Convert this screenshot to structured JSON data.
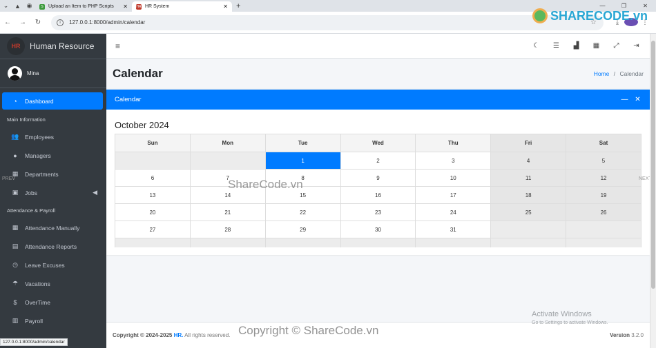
{
  "browser": {
    "tabs": [
      {
        "label": "Upload an Item to PHP Scripts",
        "favicon": "sharecode-favicon"
      },
      {
        "label": "HR System",
        "favicon": "hr-favicon"
      }
    ],
    "url": "127.0.0.1:8000/admin/calendar",
    "status_url": "127.0.0.1:8000/admin/calendar"
  },
  "watermarks": {
    "logo": "SHARECODE.vn",
    "center": "ShareCode.vn",
    "bottom": "Copyright © ShareCode.vn"
  },
  "sidebar": {
    "brand": "Human Resource",
    "brand_logo": "HR",
    "user": "Mina",
    "items": [
      {
        "label": "Dashboard",
        "icon": "dashboard-icon",
        "active": true
      },
      {
        "header": "Main Information"
      },
      {
        "label": "Employees",
        "icon": "users-icon"
      },
      {
        "label": "Managers",
        "icon": "user-icon"
      },
      {
        "label": "Departments",
        "icon": "building-icon"
      },
      {
        "label": "Jobs",
        "icon": "briefcase-icon",
        "has_children": true
      },
      {
        "header": "Attendance & Payroll"
      },
      {
        "label": "Attendance Manually",
        "icon": "calendar-icon"
      },
      {
        "label": "Attendance Reports",
        "icon": "file-icon"
      },
      {
        "label": "Leave Excuses",
        "icon": "clock-icon"
      },
      {
        "label": "Vacations",
        "icon": "umbrella-beach-icon"
      },
      {
        "label": "OverTime",
        "icon": "dollar-icon"
      },
      {
        "label": "Payroll",
        "icon": "money-icon"
      }
    ]
  },
  "topnav": {
    "icons": [
      "moon-icon",
      "list-check-icon",
      "chart-bar-icon",
      "calendar-icon",
      "expand-icon",
      "sign-out-icon"
    ]
  },
  "page": {
    "title": "Calendar",
    "breadcrumb_home": "Home",
    "breadcrumb_sep": "/",
    "breadcrumb_current": "Calendar"
  },
  "card": {
    "title": "Calendar",
    "month_label": "October 2024",
    "weekdays": [
      "Sun",
      "Mon",
      "Tue",
      "Wed",
      "Thu",
      "Fri",
      "Sat"
    ],
    "weeks": [
      [
        "",
        "",
        "1",
        "2",
        "3",
        "4",
        "5"
      ],
      [
        "6",
        "7",
        "8",
        "9",
        "10",
        "11",
        "12"
      ],
      [
        "13",
        "14",
        "15",
        "16",
        "17",
        "18",
        "19"
      ],
      [
        "20",
        "21",
        "22",
        "23",
        "24",
        "25",
        "26"
      ],
      [
        "27",
        "28",
        "29",
        "30",
        "31",
        "",
        ""
      ],
      [
        "",
        "",
        "",
        "",
        "",
        "",
        ""
      ]
    ],
    "today": "1",
    "prev_label": "PREV",
    "next_label": "NEXT"
  },
  "footer": {
    "copyright_prefix": "Copyright © 2024-2025",
    "brand_link": "HR.",
    "rights": "All rights reserved.",
    "version_label": "Version",
    "version": "3.2.0"
  },
  "activate_windows": {
    "line1": "Activate Windows",
    "line2": "Go to Settings to activate Windows."
  }
}
